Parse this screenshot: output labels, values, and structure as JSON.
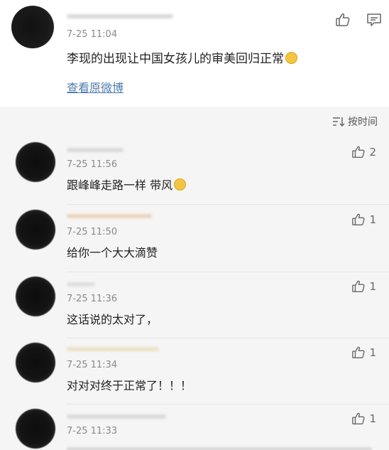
{
  "post": {
    "time": "7-25 11:04",
    "text": "李现的出现让中国女孩儿的审美回归正常",
    "view_original": "查看原微博"
  },
  "comments_header": {
    "sort_label": "按时间"
  },
  "comments": [
    {
      "time": "7-25 11:56",
      "text": "跟峰峰走路一样 带风",
      "likes": "2",
      "emoji": true
    },
    {
      "time": "7-25 11:50",
      "text": "给你一个大大滴赞",
      "likes": "1",
      "emoji": false
    },
    {
      "time": "7-25 11:36",
      "text": "这话说的太对了，",
      "likes": "1",
      "emoji": false
    },
    {
      "time": "7-25 11:34",
      "text": "对对对终于正常了！！！",
      "likes": "1",
      "emoji": false
    },
    {
      "time": "7-25 11:33",
      "text": "",
      "likes": "1",
      "emoji": false
    }
  ],
  "colors": {
    "link": "#4f7cae",
    "comments_bg": "#f5f5f5",
    "time_gray": "#8a8a8a"
  },
  "icons": {
    "like": "thumbs-up-icon",
    "comment": "comment-icon",
    "sort": "sort-icon",
    "emoji": "laughing-emoji-icon"
  }
}
